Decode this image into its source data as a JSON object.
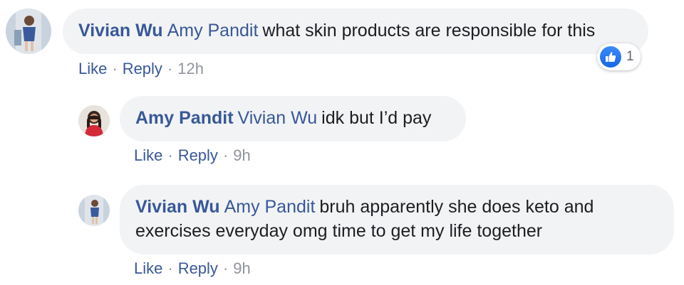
{
  "comments": [
    {
      "author": "Vivian Wu",
      "mention": "Amy Pandit",
      "text": "what skin products are responsible for this",
      "like_label": "Like",
      "reply_label": "Reply",
      "time": "12h",
      "reaction_icon": "like-icon",
      "reaction_count": "1"
    },
    {
      "author": "Amy Pandit",
      "mention": "Vivian Wu",
      "text": "idk but I’d pay",
      "like_label": "Like",
      "reply_label": "Reply",
      "time": "9h"
    },
    {
      "author": "Vivian Wu",
      "mention": "Amy Pandit",
      "text": "bruh apparently she does keto and exercises everyday omg time to get my life together",
      "like_label": "Like",
      "reply_label": "Reply",
      "time": "9h"
    }
  ],
  "colors": {
    "link": "#385898",
    "bubble": "#f2f3f5",
    "meta": "#90949c",
    "like_blue": "#1766e6"
  }
}
